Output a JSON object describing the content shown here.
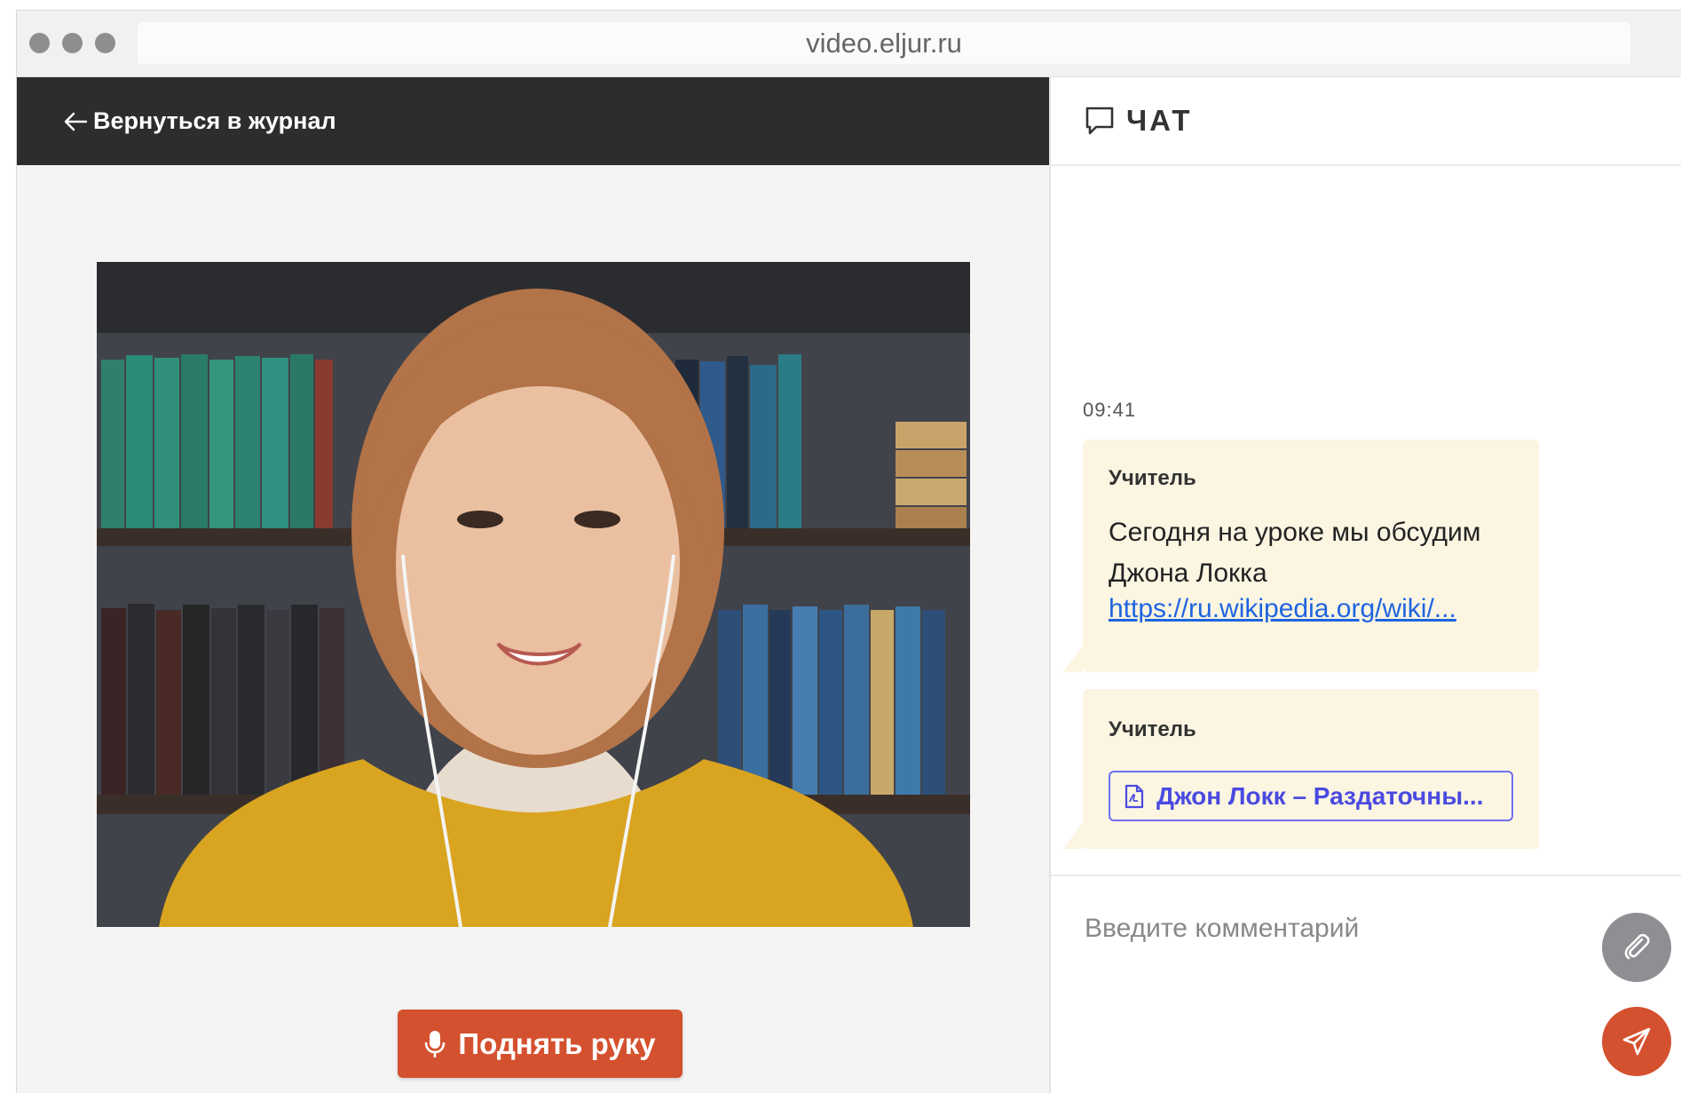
{
  "browser": {
    "url": "video.eljur.ru"
  },
  "lesson": {
    "back_label": "Вернуться в журнал",
    "raise_hand_label": "Поднять руку"
  },
  "chat": {
    "title": "ЧАТ",
    "messages": [
      {
        "time": "09:41",
        "sender": "Учитель",
        "text": "Сегодня на уроке мы обсудим Джона Локка",
        "link": "https://ru.wikipedia.org/wiki/..."
      },
      {
        "sender": "Учитель",
        "attachment": "Джон Локк – Раздаточны..."
      }
    ],
    "input_placeholder": "Введите комментарий"
  },
  "colors": {
    "accent": "#d4512f",
    "topbar": "#2d2d2d",
    "bubble": "#fbf5e2",
    "link": "#1f64e0",
    "attachment_border": "#6f6ff0"
  }
}
